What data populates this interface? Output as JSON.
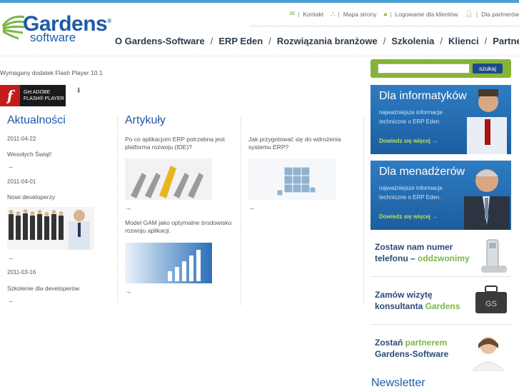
{
  "logo": {
    "brand": "Gardens",
    "sub": "software",
    "reg": "®"
  },
  "utilnav": [
    {
      "icon": "mail-icon",
      "label": "Kontakt"
    },
    {
      "icon": "sitemap-icon",
      "label": "Mapa strony"
    },
    {
      "icon": "lock-icon",
      "label": "Logowanie dla klientów"
    },
    {
      "icon": "person-icon",
      "label": "Dla partnerów"
    }
  ],
  "mainnav": [
    "O Gardens-Software",
    "ERP Eden",
    "Rozwiązania branżowe",
    "Szkolenia",
    "Klienci",
    "Partnerzy"
  ],
  "flash": {
    "message": "Wymagany dodatek Flash Player 10.1",
    "get": "Get ADOBE",
    "player": "FLASH® PLAYER"
  },
  "news": {
    "title": "Aktualności",
    "items": [
      {
        "date": "2011-04-22",
        "title": "Wesołych Świąt!"
      },
      {
        "date": "2011-04-01",
        "title": "Nowi developerzy"
      },
      {
        "date": "2011-03-16",
        "title": "Szkolenie dla developerów"
      }
    ]
  },
  "articles": {
    "title": "Artykuły",
    "items": [
      {
        "title": "Po co aplikacjom ERP potrzebna jest platforma rozwoju (IDE)?"
      },
      {
        "title": "Model GAM jako optymalne środowisko rozwoju aplikacji."
      },
      {
        "title": "Jak przygotować się do wdrożenia systemu ERP?"
      }
    ]
  },
  "search": {
    "button": "szukaj",
    "placeholder": ""
  },
  "promos": [
    {
      "title": "Dla informatyków",
      "desc1": "najważniejsze informacje",
      "desc2": "techniczne o ERP Eden.",
      "more": "Dowiedz się więcej →"
    },
    {
      "title": "Dla menadżerów",
      "desc1": "najważniejsze informacje",
      "desc2": "techniczne o ERP Eden.",
      "more": "Dowiedz się więcej →"
    }
  ],
  "ads": [
    {
      "line1": "Zostaw nam numer",
      "line2a": "telefonu – ",
      "line2b": "oddzwonimy"
    },
    {
      "line1": "Zamów wizytę",
      "line2a": "konsultanta ",
      "line2b": "Gardens",
      "badge": "GS"
    },
    {
      "line1a": "Zostań ",
      "line1b": "partnerem",
      "line2": "Gardens-Software"
    }
  ],
  "newsletter": "Newsletter",
  "colors": {
    "brand": "#1e5aa8",
    "green": "#7ab648",
    "promo": "#2a72b8"
  }
}
